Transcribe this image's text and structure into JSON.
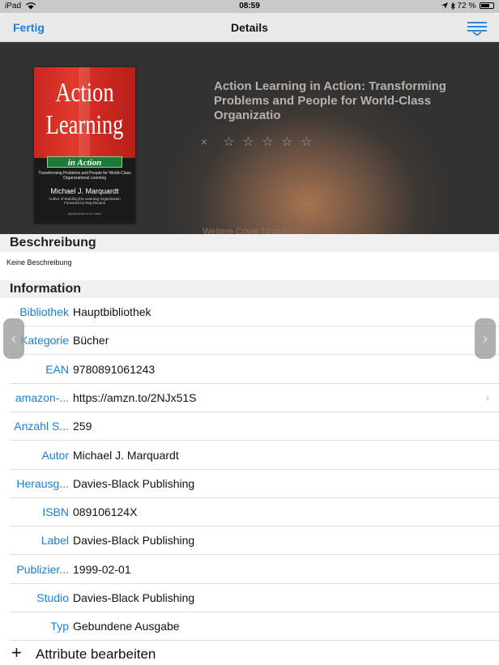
{
  "status_bar": {
    "device": "iPad",
    "time": "08:59",
    "battery": "72 %",
    "battery_level": 0.72
  },
  "nav": {
    "done_label": "Fertig",
    "title": "Details",
    "sort_icon": "filter-lines-icon"
  },
  "cover": {
    "title_line1": "Action",
    "title_line2": "Learning",
    "subtitle_badge": "in Action",
    "tagline": "Transforming Problems and People for World-Class Organizational Learning",
    "author": "Michael J. Marquardt",
    "author_note": "Author of Building the Learning Organization",
    "foreword": "Foreword by Reg Revans",
    "bottom_text": "Applications and Cases"
  },
  "item": {
    "title": "Action Learning in Action: Transforming Problems and People for World-Class Organizatio",
    "rating_clear": "×",
    "rating_max": 5,
    "rating_value": 0,
    "add_cover_label": "Weitere Cover hinzufügen"
  },
  "sections": {
    "description_header": "Beschreibung",
    "description_text": "Keine Beschreibung",
    "information_header": "Information"
  },
  "info_rows": [
    {
      "key": "Bibliothek",
      "value": "Hauptbibliothek"
    },
    {
      "key": "Kategorie",
      "value": "Bücher"
    },
    {
      "key": "EAN",
      "value": "9780891061243"
    },
    {
      "key": "amazon-...",
      "value": "https://amzn.to/2NJx51S"
    },
    {
      "key": "Anzahl S...",
      "value": "259"
    },
    {
      "key": "Autor",
      "value": "Michael J. Marquardt"
    },
    {
      "key": "Herausg...",
      "value": "Davies-Black Publishing"
    },
    {
      "key": "ISBN",
      "value": "089106124X"
    },
    {
      "key": "Label",
      "value": "Davies-Black Publishing"
    },
    {
      "key": "Publizier...",
      "value": "1999-02-01"
    },
    {
      "key": "Studio",
      "value": "Davies-Black Publishing"
    },
    {
      "key": "Typ",
      "value": "Gebundene Ausgabe"
    }
  ],
  "edit": {
    "plus": "+",
    "label": "Attribute bearbeiten"
  },
  "pager": {
    "prev": "‹",
    "next": "›"
  },
  "link_chevron": "›",
  "colors": {
    "accent": "#1a7fd6",
    "cover_red": "#e23a2e",
    "badge_green": "#1c7a3a"
  }
}
